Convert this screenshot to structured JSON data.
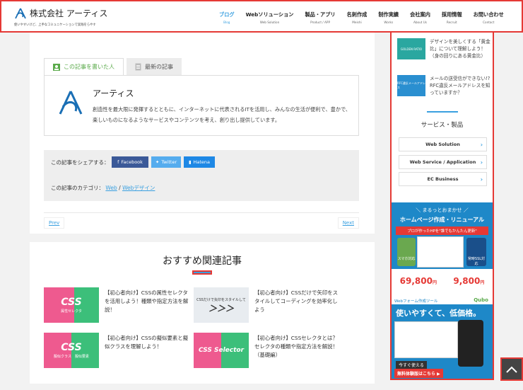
{
  "header": {
    "company": "株式会社 アーティス",
    "tagline": "使いやすいけど、上手なコミュニケーションで実践をらやす",
    "nav": [
      {
        "label": "ブログ",
        "sub": "Blog",
        "active": true
      },
      {
        "label": "Webソリューション",
        "sub": "Web Solution"
      },
      {
        "label": "製品・アプリ",
        "sub": "Product / APP"
      },
      {
        "label": "名刺作成",
        "sub": "Meishi"
      },
      {
        "label": "制作実績",
        "sub": "Works"
      },
      {
        "label": "会社案内",
        "sub": "About Us"
      },
      {
        "label": "採用情報",
        "sub": "Recruit"
      },
      {
        "label": "お問い合わせ",
        "sub": "Contact"
      }
    ]
  },
  "author": {
    "tab_author": "この記事を書いた人",
    "tab_latest": "最新の記事",
    "name": "アーティス",
    "desc": "創造性を最大限に発揮するとともに、インターネットに代表されるITを活用し、みんなの生活が便利で、豊かで、楽しいものになるようなサービスやコンテンツを考え、創り出し提供しています。"
  },
  "share": {
    "label": "この記事をシェアする：",
    "facebook": "Facebook",
    "twitter": "Twitter",
    "hatena": "Hatena",
    "category_label": "この記事のカテゴリ：",
    "cat1": "Web",
    "sep": "/",
    "cat2": "Webデザイン"
  },
  "pager": {
    "prev": "Prev",
    "next": "Next"
  },
  "related": {
    "title": "おすすめ関連記事",
    "cards": [
      {
        "thumb": "CSS",
        "thumb_sub": "属性セレクタ",
        "text": "【初心者向け】CSSの属性セレクタを活用しよう！種類や指定方法を解説！"
      },
      {
        "thumb": "＞＞＞",
        "thumb_sub": "CSSだけで矢印をスタイルして",
        "text": "【初心者向け】CSSだけで矢印をスタイルしてコーディングを効率化しよう"
      },
      {
        "thumb": "CSS",
        "thumb_sub": "擬似クラス　擬似要素",
        "text": "【初心者向け】CSSの擬似要素と擬似クラスを理解しよう！"
      },
      {
        "thumb": "CSS Selector",
        "thumb_sub": "",
        "text": "【初心者向け】CSSセレクタとは？セレクタの種類や指定方法を解説！（基礎編）"
      }
    ]
  },
  "sidebar": {
    "posts": [
      {
        "thumb": "GOLDEN RATIO",
        "text": "デザインを美しくする「黄金比」について理解しよう！（身の回りにある黄金比）"
      },
      {
        "thumb": "RFC違反メールアドレス",
        "text": "メールの送受信ができない!? RFC違反メールアドレスを知っていますか？"
      }
    ],
    "services_title": "サービス・製品",
    "services": [
      "Web Solution",
      "Web Service / Application",
      "EC Business"
    ],
    "banner1": {
      "line1": "＼ まるっとおまかせ ／",
      "line2": "ホームページ作成・リニューアル",
      "line3": "プロが作ったHPを\"誰でもかんたん更新\"",
      "price1": "69,800",
      "price2": "9,800",
      "unit": "円",
      "b1": "スマホ対応",
      "b2": "常時SSL対応"
    },
    "banner2": {
      "top": "Webフォーム作成ツール",
      "brand": "Qubo",
      "headline": "使いやすくて、低価格。",
      "cta1": "今すぐ使える",
      "cta2": "無料体験版はこちら ▶"
    }
  },
  "colors": {
    "accent": "#3aa0e0",
    "highlight": "#e53935"
  }
}
